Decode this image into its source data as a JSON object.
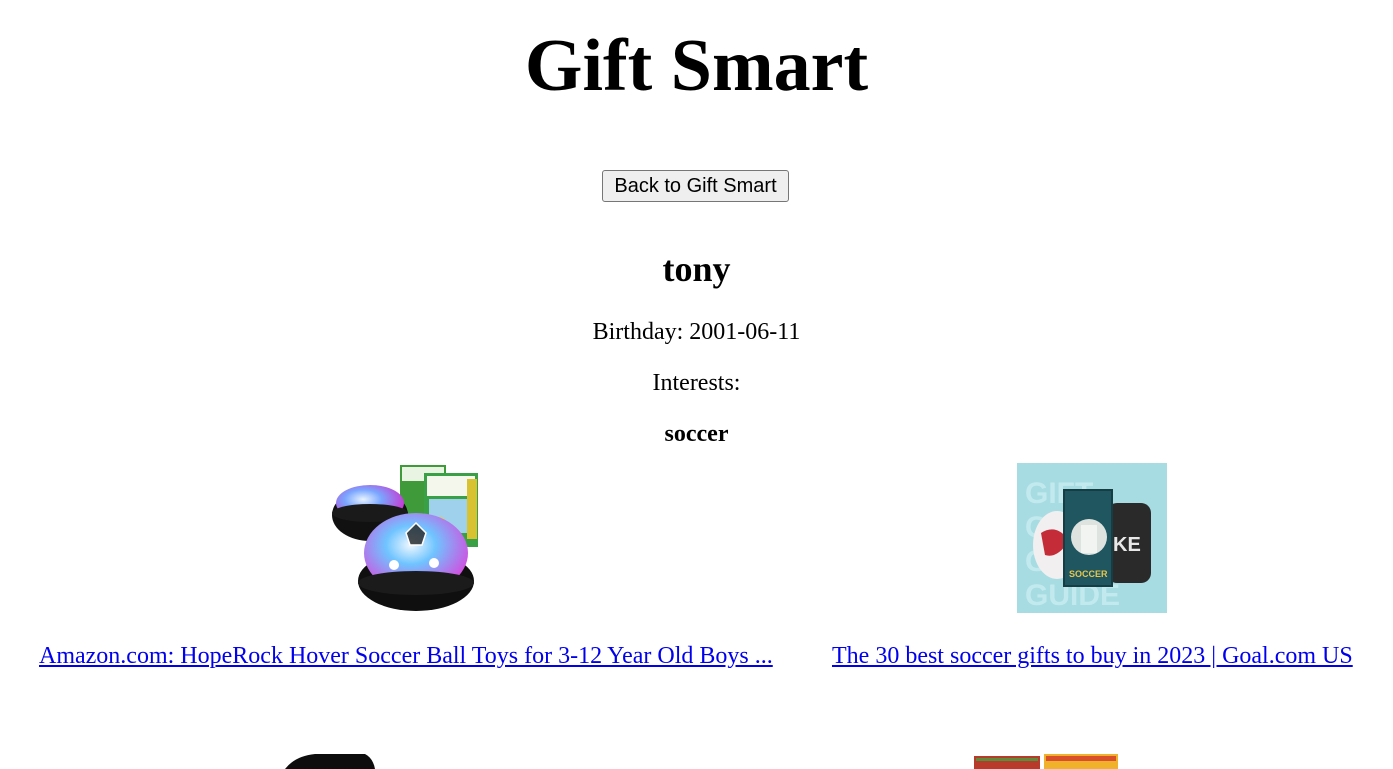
{
  "header": {
    "title": "Gift Smart",
    "back_button_label": "Back to Gift Smart"
  },
  "person": {
    "name": "tony",
    "birthday_text": "Birthday: 2001-06-11",
    "interests_label": "Interests:",
    "interests": [
      "soccer"
    ]
  },
  "gifts": [
    {
      "image": "hover-soccer-ball-product-image",
      "link_text": "Amazon.com: HopeRock Hover Soccer Ball Toys for 3-12 Year Old Boys ..."
    },
    {
      "image": "soccer-gift-guide-image",
      "link_text": "The 30 best soccer gifts to buy in 2023 | Goal.com US"
    },
    {
      "image": "black-gift-product-image"
    },
    {
      "image": "boxed-game-product-image"
    }
  ],
  "colors": {
    "link": "#0000ee",
    "button_bg": "#efefef",
    "gift_guide_bg": "#a6dce2"
  }
}
